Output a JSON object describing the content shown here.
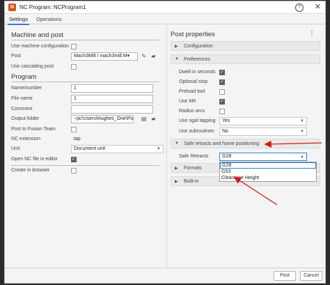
{
  "window": {
    "title": "NC Program: NCProgram1",
    "app_icon": "N"
  },
  "tabs": [
    {
      "label": "Settings"
    },
    {
      "label": "Operations"
    }
  ],
  "left": {
    "machine_section": "Machine and post",
    "use_machine_config": {
      "label": "Use machine configuration",
      "checked": false
    },
    "post": {
      "label": "Post",
      "value": "Mach3Mill / mach3mill.M▾"
    },
    "use_cascading": {
      "label": "Use cascading post",
      "checked": false
    },
    "program_section": "Program",
    "name_number": {
      "label": "Name/number",
      "value": "1"
    },
    "file_name": {
      "label": "File name",
      "value": "1"
    },
    "comment": {
      "label": "Comment",
      "value": ""
    },
    "output_folder": {
      "label": "Output folder",
      "value": "~pc\\Users\\Hughes_One\\Post"
    },
    "post_fusion": {
      "label": "Post to Fusion Team",
      "checked": false
    },
    "nc_ext": {
      "label": "NC extension",
      "value": ".tap"
    },
    "unit": {
      "label": "Unit",
      "value": "Document unit"
    },
    "open_editor": {
      "label": "Open NC file in editor",
      "checked": true
    },
    "create_browser": {
      "label": "Create in browser",
      "checked": false
    }
  },
  "right": {
    "title": "Post properties",
    "groups": {
      "configuration": "Configuration",
      "preferences": "Preferences",
      "safe": "Safe retracts and home positioning",
      "formats": "Formats",
      "builtin": "Built-in"
    },
    "prefs": {
      "dwell": {
        "label": "Dwell in seconds",
        "checked": true
      },
      "optional_stop": {
        "label": "Optional stop",
        "checked": true
      },
      "preload": {
        "label": "Preload tool",
        "checked": false
      },
      "use_m6": {
        "label": "Use M6",
        "checked": true
      },
      "radius_arcs": {
        "label": "Radius arcs",
        "checked": false
      },
      "rigid_tapping": {
        "label": "Use rigid tapping",
        "value": "Yes"
      },
      "subroutines": {
        "label": "Use subroutines",
        "value": "No"
      }
    },
    "safe_retracts": {
      "label": "Safe Retracts",
      "value": "G28",
      "options": [
        "G28",
        "G53",
        "Clearance Height"
      ]
    }
  },
  "footer": {
    "post": "Post",
    "cancel": "Cancel"
  },
  "colors": {
    "accent": "#2e7fd5",
    "annotation": "#d11a1a",
    "app_icon": "#d4541e"
  }
}
